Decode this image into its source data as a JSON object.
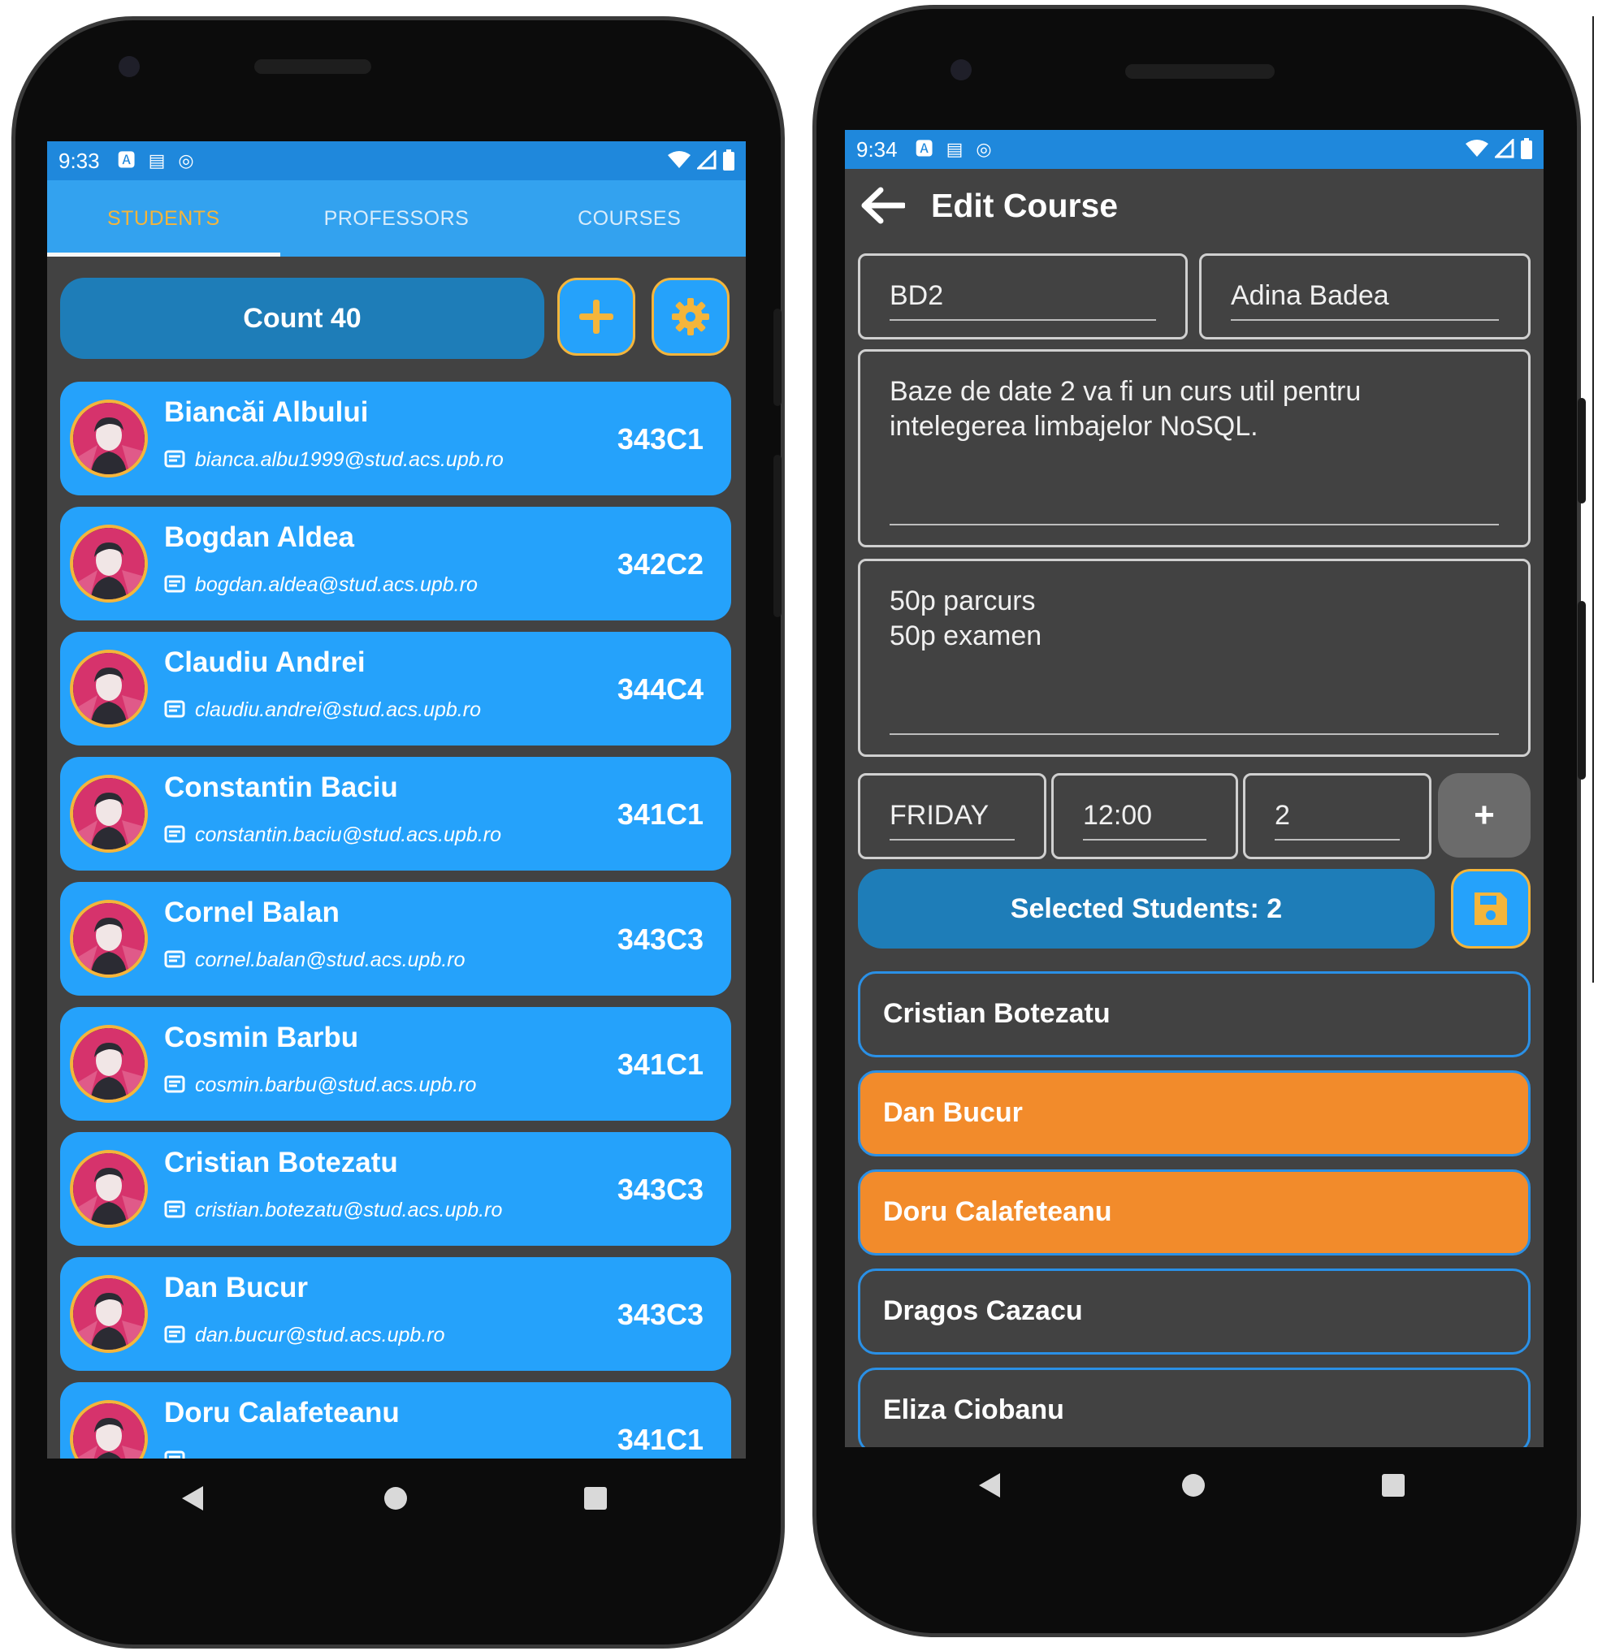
{
  "screen1": {
    "status": {
      "time": "9:33"
    },
    "tabs": [
      {
        "label": "STUDENTS",
        "active": true
      },
      {
        "label": "PROFESSORS",
        "active": false
      },
      {
        "label": "COURSES",
        "active": false
      }
    ],
    "count_label": "Count 40",
    "students": [
      {
        "name": "Biancăi Albului",
        "email": "bianca.albu1999@stud.acs.upb.ro",
        "group": "343C1"
      },
      {
        "name": "Bogdan Aldea",
        "email": "bogdan.aldea@stud.acs.upb.ro",
        "group": "342C2"
      },
      {
        "name": "Claudiu Andrei",
        "email": "claudiu.andrei@stud.acs.upb.ro",
        "group": "344C4"
      },
      {
        "name": "Constantin Baciu",
        "email": "constantin.baciu@stud.acs.upb.ro",
        "group": "341C1"
      },
      {
        "name": "Cornel Balan",
        "email": "cornel.balan@stud.acs.upb.ro",
        "group": "343C3"
      },
      {
        "name": "Cosmin Barbu",
        "email": "cosmin.barbu@stud.acs.upb.ro",
        "group": "341C1"
      },
      {
        "name": "Cristian Botezatu",
        "email": "cristian.botezatu@stud.acs.upb.ro",
        "group": "343C3"
      },
      {
        "name": "Dan Bucur",
        "email": "dan.bucur@stud.acs.upb.ro",
        "group": "343C3"
      },
      {
        "name": "Doru Calafeteanu",
        "email": "",
        "group": "341C1"
      }
    ]
  },
  "screen2": {
    "status": {
      "time": "9:34"
    },
    "title": "Edit Course",
    "course_code": "BD2",
    "professor": "Adina Badea",
    "description": "Baze de date 2 va fi un curs util pentru\nintelegerea limbajelor NoSQL.",
    "grading": "50p parcurs\n50p examen",
    "day": "FRIDAY",
    "hour": "12:00",
    "duration": "2",
    "add_label": "+",
    "selected_label": "Selected Students: 2",
    "students": [
      {
        "name": "Cristian Botezatu",
        "selected": false
      },
      {
        "name": "Dan Bucur",
        "selected": true
      },
      {
        "name": "Doru Calafeteanu",
        "selected": true
      },
      {
        "name": "Dragos Cazacu",
        "selected": false
      },
      {
        "name": "Eliza Ciobanu",
        "selected": false
      }
    ]
  },
  "colors": {
    "primary": "#25a2fb",
    "accent": "#f4b53b",
    "dark_bg": "#424242",
    "selected": "#f28b2b",
    "count_btn": "#1e7db8"
  },
  "icons": {
    "add": "plus-icon",
    "settings": "gear-icon",
    "save": "save-icon",
    "back": "arrow-back-icon",
    "email": "email-icon"
  }
}
